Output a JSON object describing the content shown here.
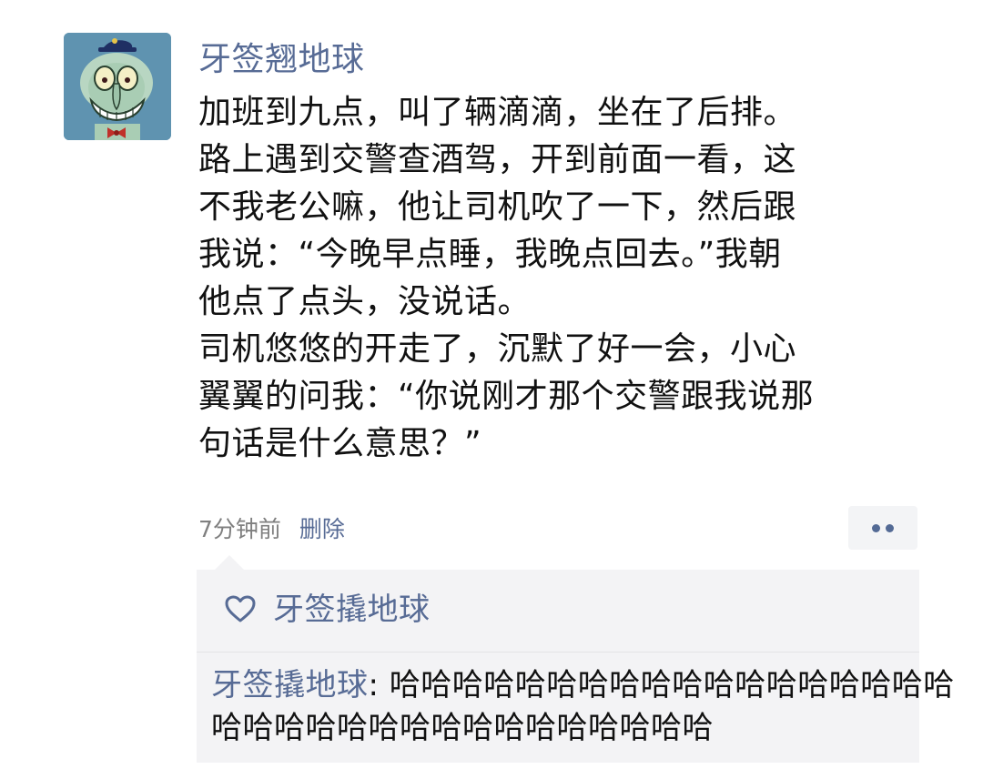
{
  "post": {
    "nickname": "牙签翘地球",
    "lines": [
      "加班到九点，叫了辆滴滴，坐在了后排。",
      "路上遇到交警查酒驾，开到前面一看，这",
      "不我老公嘛，他让司机吹了一下，然后跟",
      "我说：“今晚早点睡，我晚点回去。”我朝",
      "他点了点头，没说话。",
      "司机悠悠的开走了，沉默了好一会，小心",
      "翼翼的问我：“你说刚才那个交警跟我说那",
      "句话是什么意思？”"
    ],
    "time": "7分钟前",
    "delete_label": "删除"
  },
  "more_button": {
    "icon": "more-dots-icon"
  },
  "likes": {
    "icon": "heart-outline-icon",
    "names": "牙签撬地球"
  },
  "comment": {
    "author": "牙签撬地球",
    "separator": ":",
    "text_line1": "哈哈哈哈哈哈哈哈哈哈哈哈哈哈哈哈哈哈",
    "text_line2": "哈哈哈哈哈哈哈哈哈哈哈哈哈哈哈哈"
  },
  "colors": {
    "link_blue": "#576b95",
    "body_text": "#111111",
    "meta_gray": "#7f7f7f",
    "panel_bg": "#f3f3f5",
    "avatar_bg": "#5f93b0"
  }
}
